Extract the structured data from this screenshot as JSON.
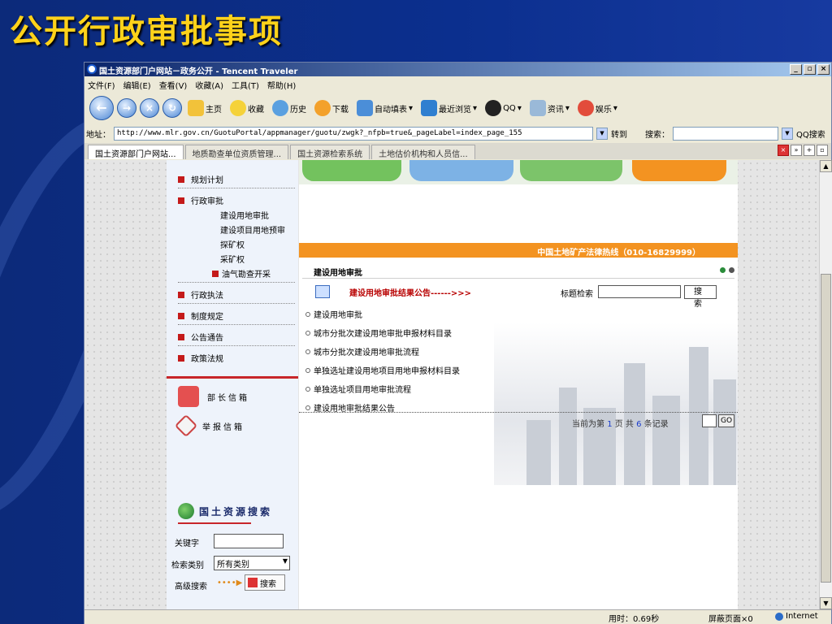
{
  "slide": {
    "title": "公开行政审批事项"
  },
  "window": {
    "title": "国土资源部门户网站－政务公开 - Tencent Traveler",
    "min": "_",
    "max": "▫",
    "close": "×"
  },
  "menu": [
    "文件(F)",
    "编辑(E)",
    "查看(V)",
    "收藏(A)",
    "工具(T)",
    "帮助(H)"
  ],
  "toolbar": {
    "home": "主页",
    "favorites": "收藏",
    "history": "历史",
    "download": "下载",
    "autofill": "自动填表",
    "recent": "最近浏览",
    "qq": "QQ",
    "news": "资讯",
    "entertainment": "娱乐"
  },
  "address": {
    "label": "地址：",
    "url": "http://www.mlr.gov.cn/GuotuPortal/appmanager/guotu/zwgk?_nfpb=true&_pageLabel=index_page_155",
    "go": "转到",
    "search_label": "搜索：",
    "qq_search": "QQ搜索"
  },
  "tabs": [
    "国土资源部门户网站...",
    "地质勘查单位资质管理...",
    "国土资源检索系统",
    "土地估价机构和人员信..."
  ],
  "sidebar": {
    "items": [
      "规划计划",
      "行政审批",
      "行政执法",
      "制度规定",
      "公告通告",
      "政策法规"
    ],
    "sub": [
      "建设用地审批",
      "建设项目用地预审",
      "探矿权",
      "采矿权",
      "油气勘查开采"
    ],
    "minister_mail": "部长信箱",
    "report_mail": "举报信箱",
    "search_title": "国土资源搜索",
    "keyword_label": "关键字",
    "category_label": "检索类别",
    "category_value": "所有类别",
    "advanced": "高级搜索",
    "search_btn": "搜索"
  },
  "main": {
    "hotline": "中国土地矿产法律热线（010-16829999）",
    "panel_title": "建设用地审批",
    "result_link": "建设用地审批结果公告------>>>",
    "title_search_label": "标题检索",
    "search_btn": "搜 索",
    "list": [
      "建设用地审批",
      "城市分批次建设用地审批申报材料目录",
      "城市分批次建设用地审批流程",
      "单独选址建设用地项目用地申报材料目录",
      "单独选址项目用地审批流程",
      "建设用地审批结果公告"
    ],
    "pager": {
      "prefix": "当前为第",
      "page": "1",
      "mid": "页 共",
      "total": "6",
      "suffix": "条记录",
      "go": "GO"
    }
  },
  "status": {
    "time": "用时：0.69秒",
    "blocked": "屏蔽页面×0",
    "zone": "Internet"
  }
}
